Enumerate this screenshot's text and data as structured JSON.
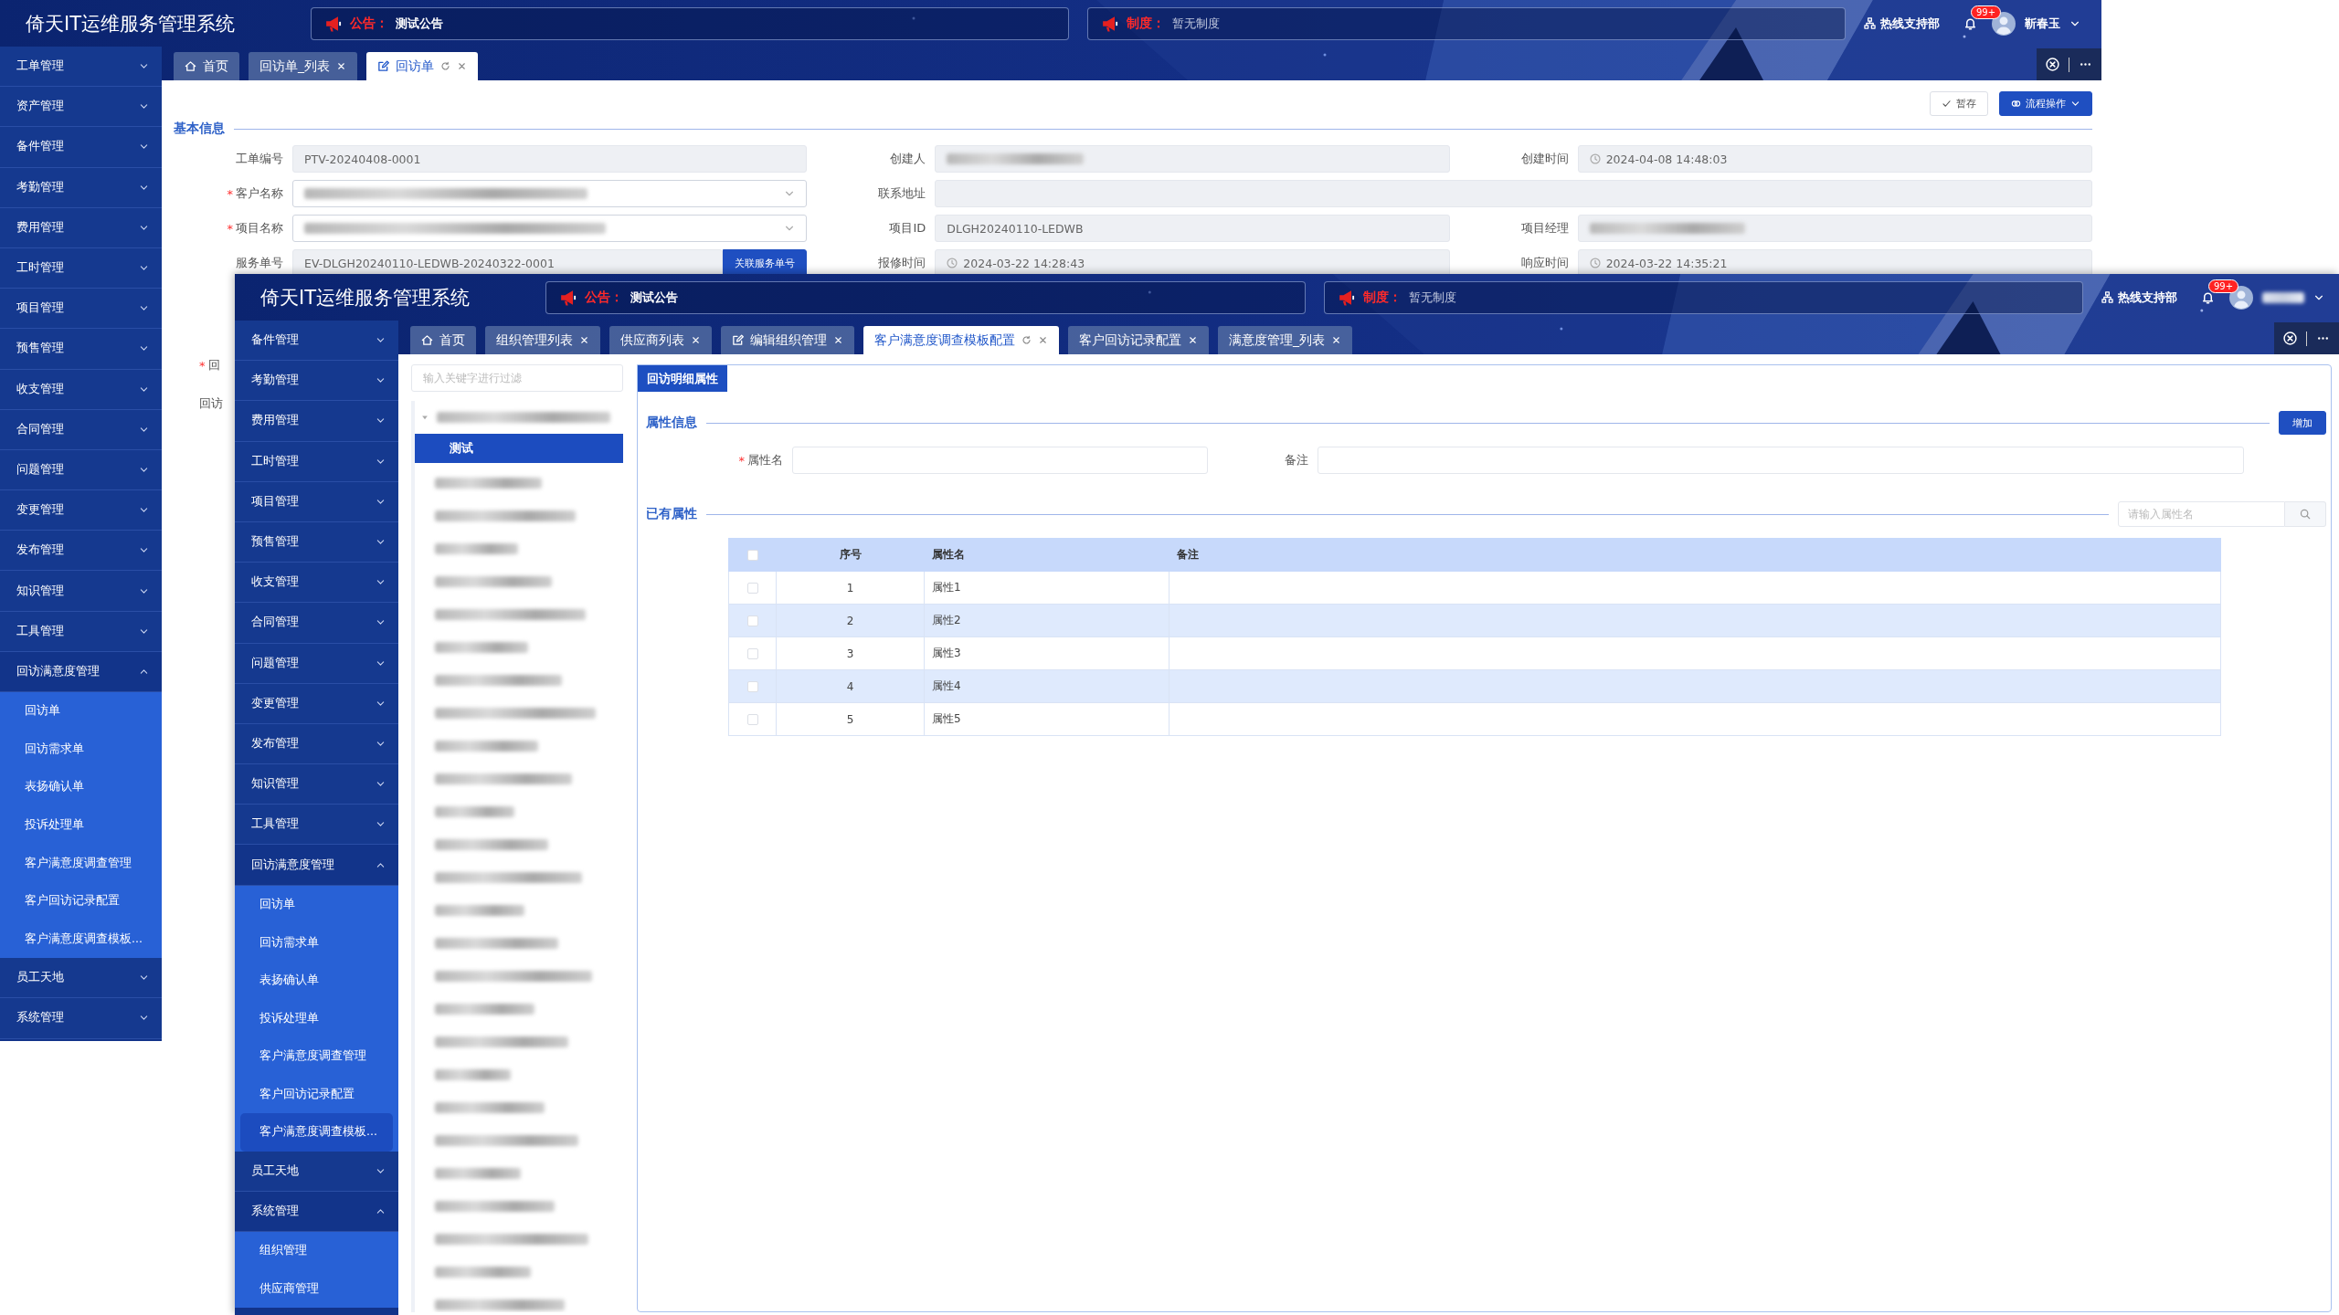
{
  "back_window": {
    "header": {
      "title": "倚天IT运维服务管理系统",
      "notices": [
        {
          "kind": "announcement",
          "label": "公告：",
          "text": "测试公告"
        },
        {
          "kind": "rule",
          "label": "制度：",
          "text": "暂无制度"
        }
      ],
      "hotline": "热线支持部",
      "notification_count": "99+",
      "user": {
        "name": "靳春玉",
        "blurred": false
      }
    },
    "sidebar": {
      "items": [
        {
          "label": "工单管理",
          "expanded": false
        },
        {
          "label": "资产管理",
          "expanded": false
        },
        {
          "label": "备件管理",
          "expanded": false
        },
        {
          "label": "考勤管理",
          "expanded": false
        },
        {
          "label": "费用管理",
          "expanded": false
        },
        {
          "label": "工时管理",
          "expanded": false
        },
        {
          "label": "项目管理",
          "expanded": false
        },
        {
          "label": "预售管理",
          "expanded": false
        },
        {
          "label": "收支管理",
          "expanded": false
        },
        {
          "label": "合同管理",
          "expanded": false
        },
        {
          "label": "问题管理",
          "expanded": false
        },
        {
          "label": "变更管理",
          "expanded": false
        },
        {
          "label": "发布管理",
          "expanded": false
        },
        {
          "label": "知识管理",
          "expanded": false
        },
        {
          "label": "工具管理",
          "expanded": false
        },
        {
          "label": "回访满意度管理",
          "expanded": true,
          "children": [
            {
              "label": "回访单",
              "selected": false
            },
            {
              "label": "回访需求单",
              "selected": false
            },
            {
              "label": "表扬确认单",
              "selected": false
            },
            {
              "label": "投诉处理单",
              "selected": false
            },
            {
              "label": "客户满意度调查管理",
              "selected": false
            },
            {
              "label": "客户回访记录配置",
              "selected": false
            },
            {
              "label": "客户满意度调查模板...",
              "selected": false
            }
          ]
        },
        {
          "label": "员工天地",
          "expanded": false
        },
        {
          "label": "系统管理",
          "expanded": false
        }
      ]
    },
    "tabs": [
      {
        "label": "首页",
        "kind": "home",
        "selected": false,
        "closable": false,
        "refreshable": false
      },
      {
        "label": "回访单_列表",
        "kind": "plain",
        "selected": false,
        "closable": true,
        "refreshable": false
      },
      {
        "label": "回访单",
        "kind": "edit",
        "selected": true,
        "closable": true,
        "refreshable": true
      }
    ],
    "toolbar": [
      {
        "label": "暂存",
        "kind": "save"
      },
      {
        "label": "流程操作",
        "kind": "workflow"
      }
    ],
    "section_title": "基本信息",
    "form": [
      {
        "label": "工单编号",
        "value": "PTV-20240408-0001",
        "kind": "text",
        "disabled": true,
        "blurred": false
      },
      {
        "label": "创建人",
        "blurred": true,
        "kind": "text",
        "disabled": true
      },
      {
        "label": "创建时间",
        "value": "2024-04-08 14:48:03",
        "kind": "datetime",
        "disabled": true,
        "blurred": false
      },
      {
        "label": "客户名称",
        "required_mark": "*",
        "blurred": true,
        "kind": "select",
        "disabled": false
      },
      {
        "label": "联系地址",
        "kind": "text",
        "disabled": true,
        "blurred": false,
        "wide": true
      },
      {
        "label": "项目名称",
        "required_mark": "*",
        "blurred": true,
        "kind": "select",
        "disabled": false
      },
      {
        "label": "项目ID",
        "value": "DLGH20240110-LEDWB",
        "kind": "text",
        "disabled": true,
        "blurred": false
      },
      {
        "label": "项目经理",
        "blurred": true,
        "kind": "text",
        "disabled": true
      },
      {
        "label": "服务单号",
        "value": "EV-DLGH20240110-LEDWB-20240322-0001",
        "kind": "text",
        "disabled": true,
        "blurred": false,
        "button": "关联服务单号"
      },
      {
        "label": "报修时间",
        "value": "2024-03-22 14:28:43",
        "kind": "datetime",
        "disabled": true,
        "blurred": false
      },
      {
        "label": "响应时间",
        "value": "2024-03-22 14:35:21",
        "kind": "datetime",
        "disabled": true,
        "blurred": false
      }
    ],
    "cut_labels": [
      {
        "required_mark": "*",
        "text": "回"
      },
      {
        "text": "回访"
      }
    ]
  },
  "front_window": {
    "header": {
      "title": "倚天IT运维服务管理系统",
      "notices": [
        {
          "kind": "announcement",
          "label": "公告：",
          "text": "测试公告"
        },
        {
          "kind": "rule",
          "label": "制度：",
          "text": "暂无制度"
        }
      ],
      "hotline": "热线支持部",
      "notification_count": "99+",
      "user": {
        "blurred": true
      }
    },
    "sidebar": {
      "items": [
        {
          "label": "备件管理",
          "expanded": false
        },
        {
          "label": "考勤管理",
          "expanded": false
        },
        {
          "label": "费用管理",
          "expanded": false
        },
        {
          "label": "工时管理",
          "expanded": false
        },
        {
          "label": "项目管理",
          "expanded": false
        },
        {
          "label": "预售管理",
          "expanded": false
        },
        {
          "label": "收支管理",
          "expanded": false
        },
        {
          "label": "合同管理",
          "expanded": false
        },
        {
          "label": "问题管理",
          "expanded": false
        },
        {
          "label": "变更管理",
          "expanded": false
        },
        {
          "label": "发布管理",
          "expanded": false
        },
        {
          "label": "知识管理",
          "expanded": false
        },
        {
          "label": "工具管理",
          "expanded": false
        },
        {
          "label": "回访满意度管理",
          "expanded": true,
          "children": [
            {
              "label": "回访单",
              "selected": false
            },
            {
              "label": "回访需求单",
              "selected": false
            },
            {
              "label": "表扬确认单",
              "selected": false
            },
            {
              "label": "投诉处理单",
              "selected": false
            },
            {
              "label": "客户满意度调查管理",
              "selected": false
            },
            {
              "label": "客户回访记录配置",
              "selected": false
            },
            {
              "label": "客户满意度调查模板...",
              "selected": true
            }
          ]
        },
        {
          "label": "员工天地",
          "expanded": false
        },
        {
          "label": "系统管理",
          "expanded": true,
          "children": [
            {
              "label": "组织管理",
              "selected": false
            },
            {
              "label": "供应商管理",
              "selected": false
            }
          ]
        }
      ]
    },
    "tabs": [
      {
        "label": "首页",
        "kind": "home",
        "selected": false,
        "closable": false,
        "refreshable": false
      },
      {
        "label": "组织管理列表",
        "kind": "plain",
        "selected": false,
        "closable": true,
        "refreshable": false
      },
      {
        "label": "供应商列表",
        "kind": "plain",
        "selected": false,
        "closable": true,
        "refreshable": false
      },
      {
        "label": "编辑组织管理",
        "kind": "edit",
        "selected": false,
        "closable": true,
        "refreshable": false
      },
      {
        "label": "客户满意度调查模板配置",
        "kind": "plain",
        "selected": true,
        "closable": true,
        "refreshable": true
      },
      {
        "label": "客户回访记录配置",
        "kind": "plain",
        "selected": false,
        "closable": true,
        "refreshable": false
      },
      {
        "label": "满意度管理_列表",
        "kind": "plain",
        "selected": false,
        "closable": true,
        "refreshable": false
      }
    ],
    "tree": {
      "filter_placeholder": "输入关键字进行过滤",
      "root": {
        "blurred": true,
        "expanded": true,
        "children": [
          {
            "label": "测试",
            "selected": true,
            "blurred": false
          },
          {
            "blurred": true,
            "selected": false
          },
          {
            "blurred": true,
            "selected": false
          },
          {
            "blurred": true,
            "selected": false
          },
          {
            "blurred": true,
            "selected": false
          },
          {
            "blurred": true,
            "selected": false
          },
          {
            "blurred": true,
            "selected": false
          },
          {
            "blurred": true,
            "selected": false
          },
          {
            "blurred": true,
            "selected": false
          },
          {
            "blurred": true,
            "selected": false
          },
          {
            "blurred": true,
            "selected": false
          },
          {
            "blurred": true,
            "selected": false
          },
          {
            "blurred": true,
            "selected": false
          },
          {
            "blurred": true,
            "selected": false
          },
          {
            "blurred": true,
            "selected": false
          },
          {
            "blurred": true,
            "selected": false
          },
          {
            "blurred": true,
            "selected": false
          },
          {
            "blurred": true,
            "selected": false
          },
          {
            "blurred": true,
            "selected": false
          },
          {
            "blurred": true,
            "selected": false
          },
          {
            "blurred": true,
            "selected": false
          },
          {
            "blurred": true,
            "selected": false
          },
          {
            "blurred": true,
            "selected": false
          },
          {
            "blurred": true,
            "selected": false
          },
          {
            "blurred": true,
            "selected": false
          },
          {
            "blurred": true,
            "selected": false
          },
          {
            "blurred": true,
            "selected": false
          }
        ]
      }
    },
    "panel": {
      "tab": "回访明细属性",
      "info_section": {
        "title": "属性信息",
        "add_button": "增加",
        "fields": [
          {
            "label": "属性名",
            "required_mark": "*"
          },
          {
            "label": "备注"
          }
        ]
      },
      "list_section": {
        "title": "已有属性",
        "search_placeholder": "请输入属性名",
        "table": {
          "header_checked": false,
          "columns": [
            "序号",
            "属性名",
            "备注"
          ],
          "rows": [
            {
              "checked": false,
              "number": "1",
              "name": "属性1"
            },
            {
              "checked": false,
              "number": "2",
              "name": "属性2"
            },
            {
              "checked": false,
              "number": "3",
              "name": "属性3"
            },
            {
              "checked": false,
              "number": "4",
              "name": "属性4"
            },
            {
              "checked": false,
              "number": "5",
              "name": "属性5"
            }
          ]
        }
      }
    }
  }
}
